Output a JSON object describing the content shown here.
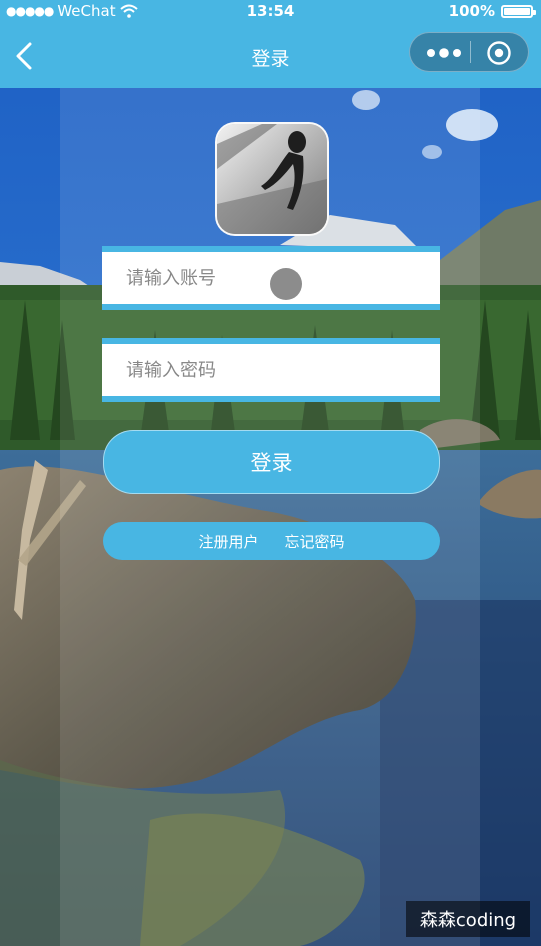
{
  "status_bar": {
    "signal_dots": "●●●●●",
    "carrier": "WeChat",
    "wifi_icon": "wifi-icon",
    "time": "13:54",
    "battery_text": "100%",
    "battery_level": 1.0
  },
  "nav": {
    "title": "登录",
    "back_icon": "back-arrow-icon",
    "more_icon": "more-dots-icon",
    "close_icon": "target-close-icon"
  },
  "form": {
    "account_placeholder": "请输入账号",
    "account_value": "",
    "password_placeholder": "请输入密码",
    "password_value": "",
    "login_label": "登录",
    "register_label": "注册用户",
    "forgot_label": "忘记密码"
  },
  "watermark": "森森coding",
  "colors": {
    "accent": "#48b6e3",
    "white": "#ffffff"
  }
}
